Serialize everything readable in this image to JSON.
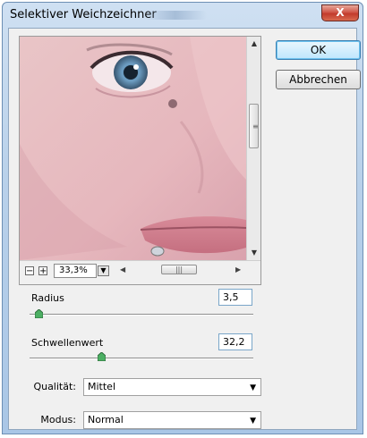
{
  "window": {
    "title": "Selektiver Weichzeichner",
    "close_label": "X"
  },
  "buttons": {
    "ok": "OK",
    "cancel": "Abbrechen"
  },
  "preview": {
    "zoom": "33,3%",
    "zoom_out": "−",
    "zoom_in": "+"
  },
  "radius": {
    "label": "Radius",
    "value": "3,5",
    "level": 0.04
  },
  "threshold": {
    "label": "Schwellenwert",
    "value": "32,2",
    "level": 0.32
  },
  "quality": {
    "label": "Qualität:",
    "value": "Mittel"
  },
  "mode": {
    "label": "Modus:",
    "value": "Normal"
  },
  "colors": {
    "accent": "#6fc3ef",
    "close": "#c23b2c",
    "knob": "#3f9a55"
  }
}
